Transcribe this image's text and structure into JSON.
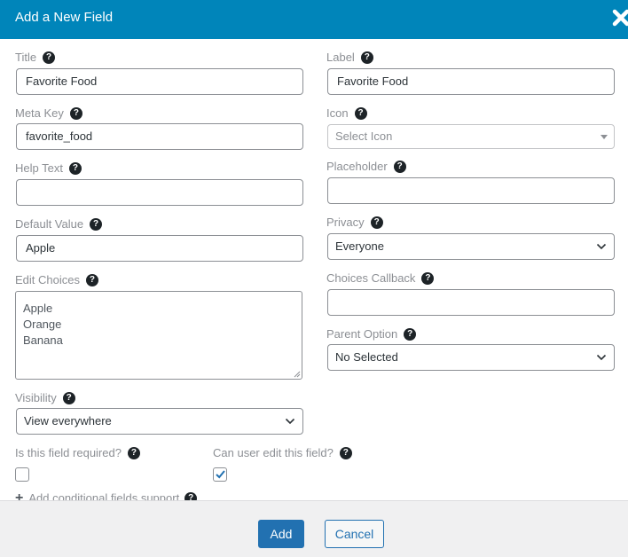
{
  "dialog": {
    "title": "Add a New Field",
    "close_icon": "close-x-icon"
  },
  "left": {
    "title": {
      "label": "Title",
      "value": "Favorite Food"
    },
    "meta_key": {
      "label": "Meta Key",
      "value": "favorite_food"
    },
    "help_text": {
      "label": "Help Text",
      "value": ""
    },
    "default_value": {
      "label": "Default Value",
      "value": "Apple"
    },
    "edit_choices": {
      "label": "Edit Choices",
      "choices": [
        "Apple",
        "Orange",
        "Banana"
      ]
    },
    "visibility": {
      "label": "Visibility",
      "selected": "View everywhere"
    }
  },
  "right": {
    "label_field": {
      "label": "Label",
      "value": "Favorite Food"
    },
    "icon": {
      "label": "Icon",
      "placeholder": "Select Icon"
    },
    "placeholder_field": {
      "label": "Placeholder",
      "value": ""
    },
    "privacy": {
      "label": "Privacy",
      "selected": "Everyone"
    },
    "choices_callback": {
      "label": "Choices Callback",
      "value": ""
    },
    "parent_option": {
      "label": "Parent Option",
      "selected": "No Selected"
    }
  },
  "checks": {
    "required": {
      "label": "Is this field required?",
      "checked": false
    },
    "user_edit": {
      "label": "Can user edit this field?",
      "checked": true
    }
  },
  "conditional": {
    "label": "Add conditional fields support"
  },
  "help_glyph": "?",
  "footer": {
    "add_label": "Add",
    "cancel_label": "Cancel"
  },
  "colors": {
    "header": "#0085ba",
    "primary": "#2271b1",
    "footer_bg": "#f0f0f1"
  }
}
